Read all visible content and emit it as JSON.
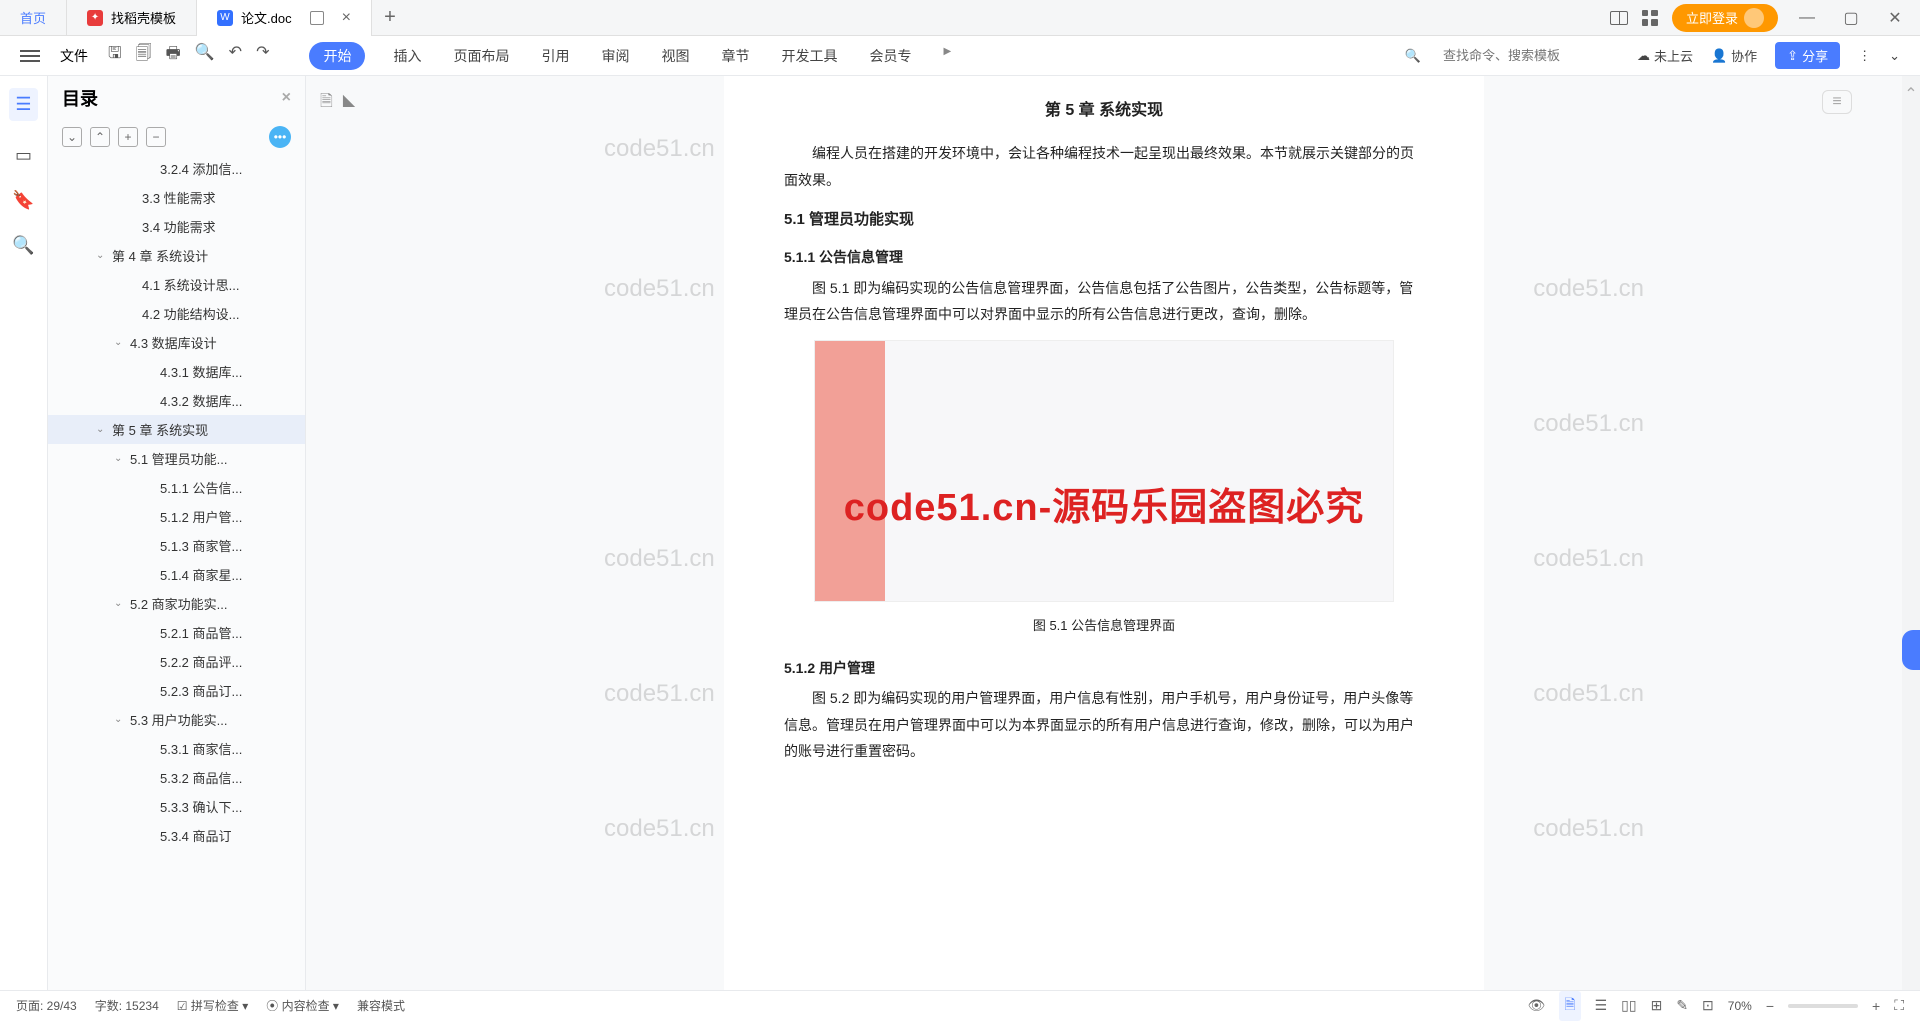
{
  "tabs": {
    "home": "首页",
    "t1": "找稻壳模板",
    "t2": "论文.doc",
    "add": "+"
  },
  "login": "立即登录",
  "toolbar": {
    "file": "文件"
  },
  "ribbon": {
    "start": "开始",
    "insert": "插入",
    "layout": "页面布局",
    "ref": "引用",
    "review": "审阅",
    "view": "视图",
    "chapter": "章节",
    "devtools": "开发工具",
    "member": "会员专"
  },
  "ribbonRight": {
    "search": "查找命令、搜索模板",
    "cloud": "未上云",
    "coop": "协作",
    "share": "分享"
  },
  "nav": {
    "title": "目录",
    "items": [
      {
        "pad": 96,
        "chev": "",
        "label": "3.2.4 添加信..."
      },
      {
        "pad": 78,
        "chev": "",
        "label": "3.3 性能需求"
      },
      {
        "pad": 78,
        "chev": "",
        "label": "3.4 功能需求"
      },
      {
        "pad": 48,
        "chev": "⌄",
        "label": "第 4 章  系统设计"
      },
      {
        "pad": 78,
        "chev": "",
        "label": "4.1 系统设计思..."
      },
      {
        "pad": 78,
        "chev": "",
        "label": "4.2 功能结构设..."
      },
      {
        "pad": 66,
        "chev": "⌄",
        "label": "4.3 数据库设计"
      },
      {
        "pad": 96,
        "chev": "",
        "label": "4.3.1 数据库..."
      },
      {
        "pad": 96,
        "chev": "",
        "label": "4.3.2 数据库..."
      },
      {
        "pad": 48,
        "chev": "⌄",
        "label": "第 5 章  系统实现",
        "sel": true
      },
      {
        "pad": 66,
        "chev": "⌄",
        "label": "5.1 管理员功能..."
      },
      {
        "pad": 96,
        "chev": "",
        "label": "5.1.1 公告信..."
      },
      {
        "pad": 96,
        "chev": "",
        "label": "5.1.2 用户管..."
      },
      {
        "pad": 96,
        "chev": "",
        "label": "5.1.3 商家管..."
      },
      {
        "pad": 96,
        "chev": "",
        "label": "5.1.4 商家星..."
      },
      {
        "pad": 66,
        "chev": "⌄",
        "label": "5.2 商家功能实..."
      },
      {
        "pad": 96,
        "chev": "",
        "label": "5.2.1 商品管..."
      },
      {
        "pad": 96,
        "chev": "",
        "label": "5.2.2 商品评..."
      },
      {
        "pad": 96,
        "chev": "",
        "label": "5.2.3 商品订..."
      },
      {
        "pad": 66,
        "chev": "⌄",
        "label": "5.3 用户功能实..."
      },
      {
        "pad": 96,
        "chev": "",
        "label": "5.3.1 商家信..."
      },
      {
        "pad": 96,
        "chev": "",
        "label": "5.3.2 商品信..."
      },
      {
        "pad": 96,
        "chev": "",
        "label": "5.3.3 确认下..."
      },
      {
        "pad": 96,
        "chev": "",
        "label": "5.3.4 商品订"
      }
    ]
  },
  "doc": {
    "chapter": "第 5 章  系统实现",
    "intro": "编程人员在搭建的开发环境中，会让各种编程技术一起呈现出最终效果。本节就展示关键部分的页面效果。",
    "s51": "5.1  管理员功能实现",
    "s511": "5.1.1  公告信息管理",
    "p511": "图 5.1 即为编码实现的公告信息管理界面，公告信息包括了公告图片，公告类型，公告标题等，管理员在公告信息管理界面中可以对界面中显示的所有公告信息进行更改，查询，删除。",
    "figcap": "图 5.1 公告信息管理界面",
    "s512": "5.1.2  用户管理",
    "p512": "图 5.2 即为编码实现的用户管理界面，用户信息有性别，用户手机号，用户身份证号，用户头像等信息。管理员在用户管理界面中可以为本界面显示的所有用户信息进行查询，修改，删除，可以为用户的账号进行重置密码。"
  },
  "watermarks": {
    "wm": "code51.cn",
    "big": "code51.cn-源码乐园盗图必究"
  },
  "status": {
    "page": "页面: 29/43",
    "words": "字数: 15234",
    "spell": "拼写检查",
    "content": "内容检查",
    "compat": "兼容模式",
    "zoom": "70%"
  }
}
